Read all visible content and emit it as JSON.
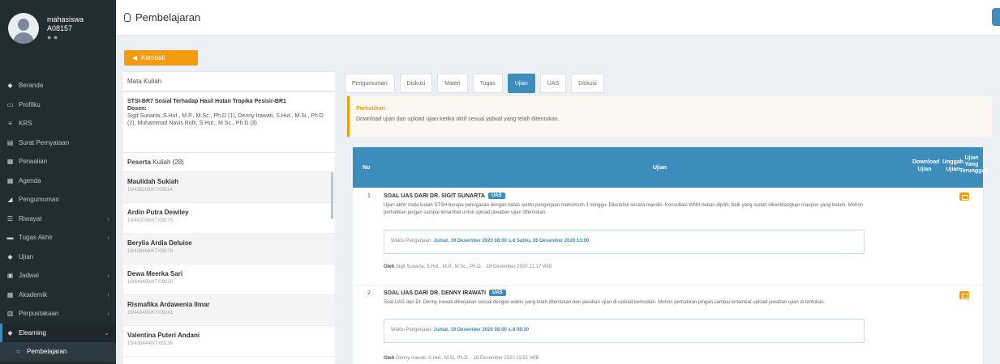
{
  "sidebar": {
    "user_name": "mahasiswa",
    "user_id": "A08157",
    "user_status": "● ●",
    "menu": [
      {
        "label": "Beranda",
        "icon": "dashboard-icon",
        "glyph": "◆",
        "chevron": ""
      },
      {
        "label": "Profilku",
        "icon": "monitor-icon",
        "glyph": "▭",
        "chevron": ""
      },
      {
        "label": "KRS",
        "icon": "list-icon",
        "glyph": "≡",
        "chevron": ""
      },
      {
        "label": "Surat Pernyataan",
        "icon": "file-icon",
        "glyph": "▤",
        "chevron": ""
      },
      {
        "label": "Perwalian",
        "icon": "table-icon",
        "glyph": "▦",
        "chevron": ""
      },
      {
        "label": "Agenda",
        "icon": "calendar-icon",
        "glyph": "▦",
        "chevron": ""
      },
      {
        "label": "Pengumuman",
        "icon": "bullhorn-icon",
        "glyph": "◢",
        "chevron": ""
      },
      {
        "label": "Riwayat",
        "icon": "history-icon",
        "glyph": "☰",
        "chevron": "‹"
      },
      {
        "label": "Tugas Akhir",
        "icon": "bed-icon",
        "glyph": "▬",
        "chevron": "‹"
      },
      {
        "label": "Ujian",
        "icon": "edit-icon",
        "glyph": "◆",
        "chevron": ""
      },
      {
        "label": "Jadwal",
        "icon": "clipboard-icon",
        "glyph": "▣",
        "chevron": "‹"
      },
      {
        "label": "Akademik",
        "icon": "users-icon",
        "glyph": "▦",
        "chevron": "‹"
      },
      {
        "label": "Perpustakaan",
        "icon": "book-icon",
        "glyph": "▥",
        "chevron": "‹"
      },
      {
        "label": "Elearning",
        "icon": "graduation-icon",
        "glyph": "◆",
        "chevron": "⌄"
      },
      {
        "label": "Pembelajaran",
        "icon": "circle-icon",
        "glyph": "○",
        "chevron": ""
      }
    ]
  },
  "header": {
    "title": "Pembelajaran"
  },
  "back_button": "Kembali",
  "matakuliah": {
    "heading": "Mata Kuliah",
    "course": "STSI-BR7 Sosial Terhadap Hasil Hutan Tropika Pesisir-BR1",
    "dosen_label": "Dosen:",
    "dosen_text": "Sigit Sunarta, S.Hut., M.P., M.Sc., Ph.D (1), Denny Irawati, S.Hut., M.Si., Ph.D (2), Muhammad Navis Rofii, S.Hut., M.Sc., Ph.D (3)"
  },
  "peserta": {
    "heading_bold": "Peserta",
    "heading_rest": "Kuliah (28)",
    "items": [
      {
        "name": "Maulidah Sukiah",
        "nim": "19/438283/KT/09114"
      },
      {
        "name": "Ardin Putra Dewiley",
        "nim": "19/442036/KT/09175"
      },
      {
        "name": "Berylia Ardia Deluise",
        "nim": "19/438466/KT/09178"
      },
      {
        "name": "Dewa Meerka Sari",
        "nim": "19/443489/KT/09220"
      },
      {
        "name": "Rismafika Ardawenia Ilmar",
        "nim": "19/443490/KT/09241"
      },
      {
        "name": "Valentina Puteri Andani",
        "nim": "19/438444/KT/09138"
      }
    ]
  },
  "tabs": [
    "Pengumuman",
    "Diskusi",
    "Materi",
    "Tugas",
    "Ujian",
    "UAS",
    "Diskusi"
  ],
  "alert": {
    "title": "Perhatikan",
    "text": "Download ujian dan upload ujian ketika aktif sesuai jadwal yang telah ditentukan."
  },
  "table": {
    "headers": {
      "no": "No",
      "ujian": "Ujian",
      "download": "Download Ujian",
      "unggah": "Unggah Ujian",
      "tergunggah": "Ujian Yang Terunggah"
    },
    "rows": [
      {
        "no": "1",
        "title": "SOAL UAS DARI DR. SIGIT SUNARTA",
        "badge": "UAS",
        "desc": "Ujian akhir mata kuliah STSH berupa penugasan dengan batas waktu pengerjaan maksimum 1 minggu. Diketahui secara mandiri. Konsultasi WNH bebas dipilih, baik yang sudah dikembangkan maupun yang belum. Mohon perhatikan jangan sampai terlambat untuk upload jawaban ujian ditentukan.",
        "waktu_label": "Waktu Pengerjaan:",
        "waktu_value": "Jumat, 19 Desember 2020 08:00 s.d Sabtu, 26 Desember 2020 13:00",
        "oleh_label": "Oleh",
        "oleh_value": "Sigit Sunarta, S.Hut., M.P., M.Sc., Ph.D. · 18 Desember 2020 21:17 WIB"
      },
      {
        "no": "2",
        "title": "SOAL UAS DARI DR. DENNY IRAWATI",
        "badge": "UAS",
        "desc": "Soal UAS dari Dr. Denny Irawati dikerjakan sesuai dengan waktu yang telah ditentukan dan jawaban ujian di upload kemudian. Mohon perhatikan jangan sampai terlambat upload jawaban ujian di tentukan.",
        "waktu_label": "Waktu Pengerjaan:",
        "waktu_value": "Jumat, 19 Desember 2020 08:00 s.d 08:30",
        "oleh_label": "Oleh",
        "oleh_value": "Denny Irawati, S.Hut., M.Si, Ph.D. · 18 Desember 2020 22:51 WIB"
      }
    ]
  }
}
